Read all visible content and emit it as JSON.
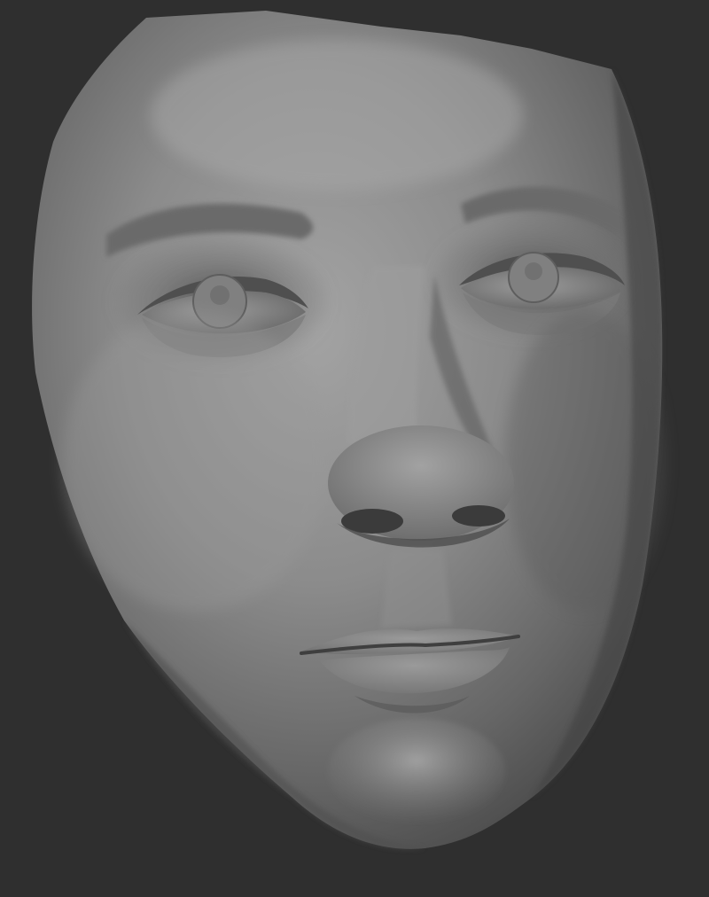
{
  "viewport": {
    "background_color": "#2f2f2f",
    "subject": "face-sculpt",
    "material_color": "#8c8c8c"
  }
}
